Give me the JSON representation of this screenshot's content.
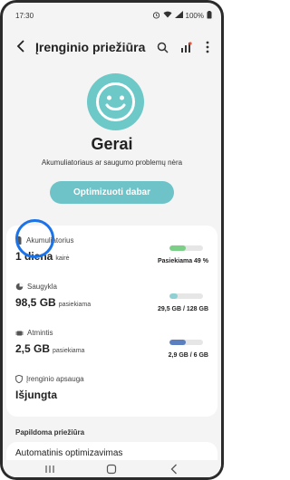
{
  "status_bar": {
    "time": "17:30",
    "battery": "100%"
  },
  "header": {
    "title": "Įrenginio priežiūra"
  },
  "hero": {
    "status": "Gerai",
    "subtitle": "Akumuliatoriaus ar saugumo problemų nėra",
    "button": "Optimizuoti dabar"
  },
  "items": {
    "battery": {
      "label": "Akumuliatorius",
      "value": "1 diena",
      "suffix": "kairė",
      "right": "Pasiekiama 49 %",
      "level": 0.49
    },
    "storage": {
      "label": "Saugykla",
      "value": "98,5 GB",
      "suffix": "pasiekiama",
      "right": "29,5 GB / 128 GB",
      "level": 0.23
    },
    "memory": {
      "label": "Atmintis",
      "value": "2,5 GB",
      "suffix": "pasiekiama",
      "right": "2,9 GB / 6 GB",
      "level": 0.48
    },
    "protection": {
      "label": "Įrenginio apsauga",
      "value": "Išjungta"
    }
  },
  "section": {
    "title": "Papildoma priežiūra"
  },
  "next": {
    "label": "Automatinis optimizavimas"
  },
  "colors": {
    "accent": "#6dc3c8",
    "battery_bar": "#7ccf86",
    "storage_bar": "#8fd1d3",
    "memory_bar": "#5b7fbf",
    "highlight": "#1a73e8"
  }
}
